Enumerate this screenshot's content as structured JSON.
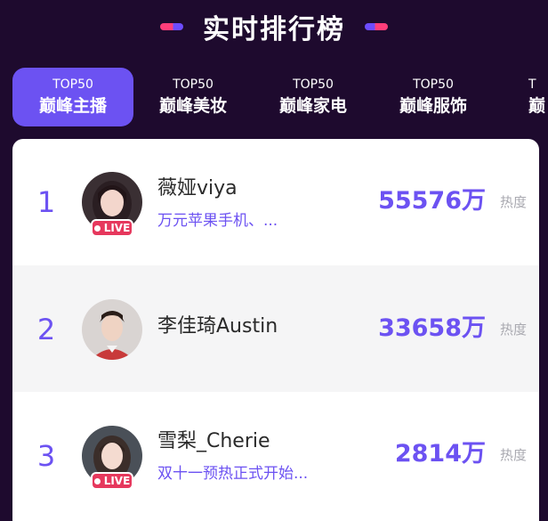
{
  "header": {
    "title": "实时排行榜"
  },
  "tabs": [
    {
      "top": "TOP50",
      "label": "巅峰主播",
      "active": true
    },
    {
      "top": "TOP50",
      "label": "巅峰美妆",
      "active": false
    },
    {
      "top": "TOP50",
      "label": "巅峰家电",
      "active": false
    },
    {
      "top": "TOP50",
      "label": "巅峰服饰",
      "active": false
    },
    {
      "top": "T",
      "label": "巅",
      "active": false
    }
  ],
  "ranking": [
    {
      "rank": "1",
      "name": "薇娅viya",
      "subtitle": "万元苹果手机、...",
      "score": "55576万",
      "heat_label": "热度",
      "live": true,
      "live_label": "LIVE"
    },
    {
      "rank": "2",
      "name": "李佳琦Austin",
      "subtitle": "",
      "score": "33658万",
      "heat_label": "热度",
      "live": false,
      "live_label": ""
    },
    {
      "rank": "3",
      "name": "雪梨_Cherie",
      "subtitle": "双十一预热正式开始...",
      "score": "2814万",
      "heat_label": "热度",
      "live": true,
      "live_label": "LIVE"
    }
  ],
  "colors": {
    "accent": "#6c52f2",
    "background": "#1e0a2e",
    "live": "#e6385d",
    "dash_pink": "#ff3e7a"
  }
}
